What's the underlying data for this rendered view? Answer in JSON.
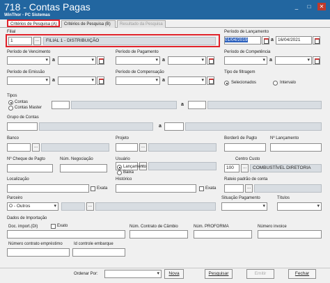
{
  "window": {
    "title": "718 - Contas Pagas",
    "subtitle": "WinThor - PC Sistemas",
    "minimize": "_",
    "restore": "□",
    "close": "✕"
  },
  "tabs": [
    {
      "label": "Critérios de Pesquisa (A)"
    },
    {
      "label": "Critérios de Pesquisa (B)"
    },
    {
      "label": "Resultado da Pesquisa"
    }
  ],
  "filial": {
    "label": "Filial",
    "code": "1",
    "dots": "...",
    "name": "FILIAL 1 - DISTRIBUIÇÃO"
  },
  "periodo_lancamento": {
    "label": "Período de Lançamento",
    "start": "01/04/2019",
    "sep": "a",
    "end": "16/04/2021"
  },
  "vencimento": {
    "label": "Período de Vencimento",
    "sep": "a"
  },
  "pagamento": {
    "label": "Período de Pagamento",
    "sep": "a"
  },
  "competencia": {
    "label": "Período de Competência",
    "sep": "a"
  },
  "emissao": {
    "label": "Período de Emissão",
    "sep": "a"
  },
  "compensacao": {
    "label": "Período de Compensação",
    "sep": "a"
  },
  "tipo_filtragem": {
    "label": "Tipo de filtragem",
    "selecionados": "Selecionados",
    "intervalo": "Intervalo"
  },
  "tipos": {
    "label": "Tipos",
    "contas": "Contas",
    "contas_master": "Contas Master",
    "sep": "a"
  },
  "grupo_contas": {
    "label": "Grupo de Contas",
    "sep": "a"
  },
  "banco": {
    "label": "Banco",
    "dots": "..."
  },
  "projeto": {
    "label": "Projeto",
    "dots": "..."
  },
  "bordero": {
    "label": "Borderô de Pagto"
  },
  "lancamento_num": {
    "label": "Nº Lançamento"
  },
  "cheque": {
    "label": "Nº Cheque de Pagto"
  },
  "negociacao": {
    "label": "Núm. Negociação"
  },
  "usuario": {
    "label": "Usuário",
    "dots": "...",
    "lancamento": "Lançamento",
    "baixa": "Baixa"
  },
  "centro_custo": {
    "label": "Centro Custo",
    "code": "100",
    "dots": "...",
    "name": "COMBUSTÍVEL DIRETORIA"
  },
  "localizacao": {
    "label": "Localização",
    "exata": "Exata"
  },
  "historico": {
    "label": "Histórico",
    "exata": "Exata"
  },
  "rateio": {
    "label": "Rateio padrão de conta",
    "dots": "..."
  },
  "parceiro": {
    "label": "Parceiro",
    "value": "O - Outros",
    "dots": "..."
  },
  "situacao": {
    "label": "Situação Pagamento"
  },
  "titulos": {
    "label": "Títulos"
  },
  "importacao": {
    "label": "Dados de Importação",
    "doc_label": "Doc. import.(DI)",
    "exato": "Exato",
    "cambio_label": "Núm. Contrato de Câmbio",
    "proforma_label": "Núm. PROFORMA",
    "invoice_label": "Número invoice",
    "emprestimo_label": "Número contrato empréstimo",
    "embarque_label": "Id controle embarque"
  },
  "footer": {
    "ordenar_label": "Ordenar Por:",
    "nova": "Nova",
    "pesquisar": "Pesquisar",
    "emitir": "Emitir",
    "fechar": "Fechar"
  }
}
